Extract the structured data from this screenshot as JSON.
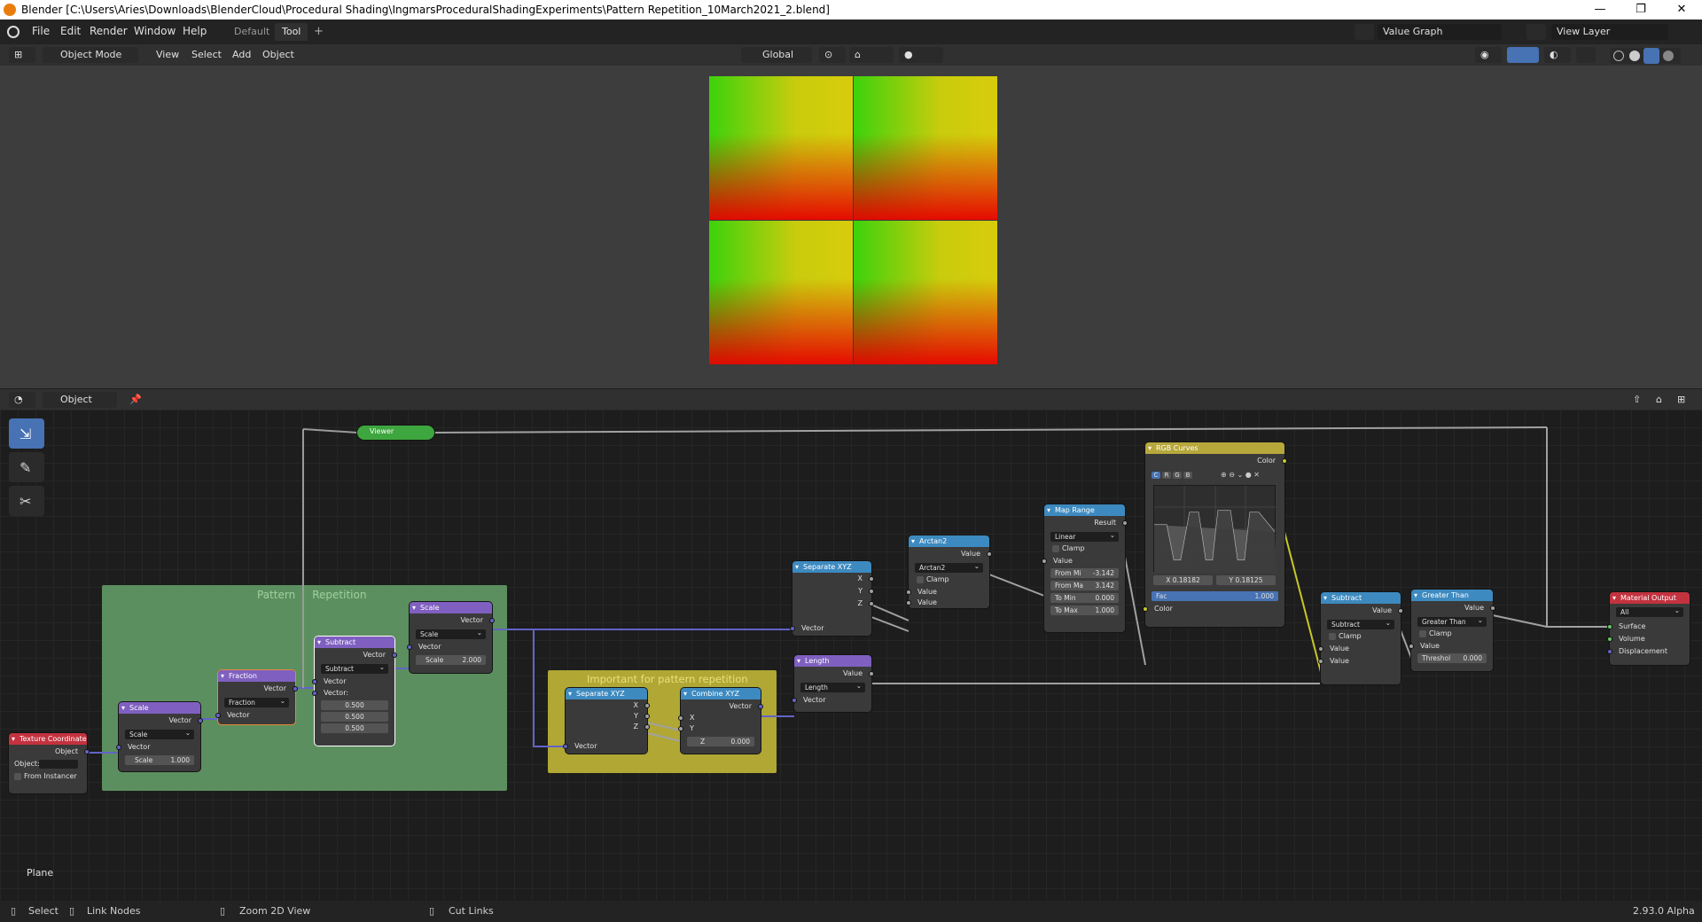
{
  "window": {
    "title": "Blender [C:\\Users\\Aries\\Downloads\\BlenderCloud\\Procedural Shading\\IngmarsProceduralShadingExperiments\\Pattern Repetition_10March2021_2.blend]",
    "min": "—",
    "max": "❐",
    "close": "✕"
  },
  "menu": [
    "File",
    "Edit",
    "Render",
    "Window",
    "Help"
  ],
  "workspaces": [
    "Default",
    "Tool"
  ],
  "workspace_add": "+",
  "scene": "Value Graph",
  "view_layer": "View Layer",
  "viewport_header": {
    "mode": "Object Mode",
    "menus": [
      "View",
      "Select",
      "Add",
      "Object"
    ],
    "orientation": "Global"
  },
  "node_header": {
    "type": "Object"
  },
  "frames": {
    "pattern": "Pattern     Repetition",
    "important": "Important for pattern repetition"
  },
  "nodes": {
    "viewer": {
      "title": "Viewer"
    },
    "texcoord": {
      "title": "Texture Coordinate",
      "out": "Object",
      "object_label": "Object:",
      "from_instancer": "From Instancer"
    },
    "scale1": {
      "title": "Scale",
      "out": "Vector",
      "op": "Scale",
      "in": "Vector",
      "scale_label": "Scale",
      "scale_value": "1.000"
    },
    "fraction": {
      "title": "Fraction",
      "out": "Vector",
      "op": "Fraction",
      "in": "Vector"
    },
    "subtract1": {
      "title": "Subtract",
      "out": "Vector",
      "op": "Subtract",
      "in": "Vector",
      "in2": "Vector:",
      "v1": "0.500",
      "v2": "0.500",
      "v3": "0.500"
    },
    "scale2": {
      "title": "Scale",
      "out": "Vector",
      "op": "Scale",
      "in": "Vector",
      "scale_label": "Scale",
      "scale_value": "2.000"
    },
    "separate1": {
      "title": "Separate XYZ",
      "x": "X",
      "y": "Y",
      "z": "Z",
      "in": "Vector"
    },
    "combine": {
      "title": "Combine XYZ",
      "out": "Vector",
      "x": "X",
      "y": "Y",
      "z_label": "Z",
      "z_value": "0.000"
    },
    "separate2": {
      "title": "Separate XYZ",
      "x": "X",
      "y": "Y",
      "z": "Z",
      "in": "Vector"
    },
    "length": {
      "title": "Length",
      "out": "Value",
      "op": "Length",
      "in": "Vector"
    },
    "arctan": {
      "title": "Arctan2",
      "out": "Value",
      "op": "Arctan2",
      "clamp": "Clamp",
      "in1": "Value",
      "in2": "Value"
    },
    "maprange": {
      "title": "Map Range",
      "out": "Result",
      "op": "Linear",
      "clamp": "Clamp",
      "in": "Value",
      "fmin_l": "From Mi",
      "fmin_v": "-3.142",
      "fmax_l": "From Ma",
      "fmax_v": "3.142",
      "tmin_l": "To Min",
      "tmin_v": "0.000",
      "tmax_l": "To Max",
      "tmax_v": "1.000"
    },
    "curves": {
      "title": "RGB Curves",
      "out": "Color",
      "tabs": [
        "C",
        "R",
        "G",
        "B"
      ],
      "x": "X 0.18182",
      "y": "Y 0.18125",
      "fac_l": "Fac",
      "fac_v": "1.000",
      "in": "Color"
    },
    "subtract2": {
      "title": "Subtract",
      "out": "Value",
      "op": "Subtract",
      "clamp": "Clamp",
      "in1": "Value",
      "in2": "Value"
    },
    "greater": {
      "title": "Greater Than",
      "out": "Value",
      "op": "Greater Than",
      "clamp": "Clamp",
      "in": "Value",
      "thr_l": "Threshol",
      "thr_v": "0.000"
    },
    "matout": {
      "title": "Material Output",
      "target": "All",
      "surface": "Surface",
      "volume": "Volume",
      "displacement": "Displacement"
    }
  },
  "object_name": "Plane",
  "status": {
    "select": "Select",
    "link": "Link Nodes",
    "zoom": "Zoom 2D View",
    "cut": "Cut Links",
    "version": "2.93.0 Alpha"
  },
  "colors": {
    "accent": "#4772b3",
    "vector_header": "#7f60c0",
    "converter_header": "#3d8ac0",
    "input_header": "#c3323f",
    "color_header": "#b7a83c",
    "frame_green": "#5c8f5f",
    "frame_yellow": "#b0a735"
  }
}
